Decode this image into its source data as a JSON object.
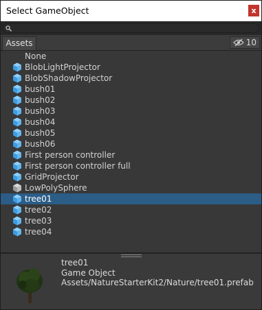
{
  "window": {
    "title": "Select GameObject",
    "close_label": "x"
  },
  "search": {
    "value": "",
    "placeholder": ""
  },
  "tabs": {
    "assets_label": "Assets",
    "hidden_count": "10"
  },
  "items": [
    {
      "label": "None",
      "icon": ""
    },
    {
      "label": "BlobLightProjector",
      "icon": "prefab-icon"
    },
    {
      "label": "BlobShadowProjector",
      "icon": "prefab-icon"
    },
    {
      "label": "bush01",
      "icon": "prefab-icon"
    },
    {
      "label": "bush02",
      "icon": "prefab-icon"
    },
    {
      "label": "bush03",
      "icon": "prefab-icon"
    },
    {
      "label": "bush04",
      "icon": "prefab-icon"
    },
    {
      "label": "bush05",
      "icon": "prefab-icon"
    },
    {
      "label": "bush06",
      "icon": "prefab-icon"
    },
    {
      "label": "First person controller",
      "icon": "prefab-icon"
    },
    {
      "label": "First person controller full",
      "icon": "prefab-icon"
    },
    {
      "label": "GridProjector",
      "icon": "prefab-icon"
    },
    {
      "label": "LowPolySphere",
      "icon": "model-icon"
    },
    {
      "label": "tree01",
      "icon": "prefab-icon",
      "selected": true
    },
    {
      "label": "tree02",
      "icon": "prefab-icon"
    },
    {
      "label": "tree03",
      "icon": "prefab-icon"
    },
    {
      "label": "tree04",
      "icon": "prefab-icon"
    }
  ],
  "preview": {
    "name": "tree01",
    "type": "Game Object",
    "path": "Assets/NatureStarterKit2/Nature/tree01.prefab",
    "thumbnail_icon": "tree-icon"
  },
  "colors": {
    "selection": "#2c5d87",
    "prefab_icon": "#4ea6e8",
    "close_button": "#c1352c"
  }
}
